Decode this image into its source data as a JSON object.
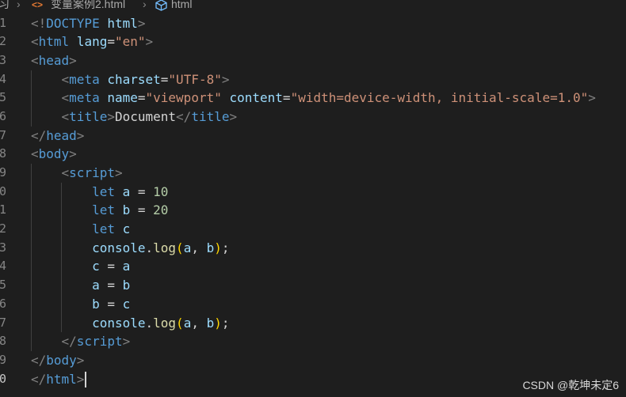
{
  "breadcrumb": {
    "folder": "习",
    "file": "变量案例2.html",
    "symbol": "html",
    "icons": {
      "separator": "chevron-right-icon",
      "file": "html-file-icon",
      "symbol": "symbol-box-icon"
    }
  },
  "editor": {
    "line_numbers": [
      "1",
      "2",
      "3",
      "4",
      "5",
      "6",
      "7",
      "8",
      "9",
      "0",
      "1",
      "2",
      "3",
      "4",
      "5",
      "6",
      "7",
      "8",
      "9",
      "0"
    ],
    "lines": [
      [
        [
          "tag-b",
          "<!"
        ],
        [
          "tag",
          "DOCTYPE"
        ],
        [
          "txt",
          " "
        ],
        [
          "attr",
          "html"
        ],
        [
          "tag-b",
          ">"
        ]
      ],
      [
        [
          "tag-b",
          "<"
        ],
        [
          "tag",
          "html"
        ],
        [
          "txt",
          " "
        ],
        [
          "attr",
          "lang"
        ],
        [
          "txt",
          "="
        ],
        [
          "str",
          "\"en\""
        ],
        [
          "tag-b",
          ">"
        ]
      ],
      [
        [
          "tag-b",
          "<"
        ],
        [
          "tag",
          "head"
        ],
        [
          "tag-b",
          ">"
        ]
      ],
      [
        [
          "txt",
          "    "
        ],
        [
          "tag-b",
          "<"
        ],
        [
          "tag",
          "meta"
        ],
        [
          "txt",
          " "
        ],
        [
          "attr",
          "charset"
        ],
        [
          "txt",
          "="
        ],
        [
          "str",
          "\"UTF-8\""
        ],
        [
          "tag-b",
          ">"
        ]
      ],
      [
        [
          "txt",
          "    "
        ],
        [
          "tag-b",
          "<"
        ],
        [
          "tag",
          "meta"
        ],
        [
          "txt",
          " "
        ],
        [
          "attr",
          "name"
        ],
        [
          "txt",
          "="
        ],
        [
          "str",
          "\"viewport\""
        ],
        [
          "txt",
          " "
        ],
        [
          "attr",
          "content"
        ],
        [
          "txt",
          "="
        ],
        [
          "str",
          "\"width=device-width, initial-scale=1.0\""
        ],
        [
          "tag-b",
          ">"
        ]
      ],
      [
        [
          "txt",
          "    "
        ],
        [
          "tag-b",
          "<"
        ],
        [
          "tag",
          "title"
        ],
        [
          "tag-b",
          ">"
        ],
        [
          "txt",
          "Document"
        ],
        [
          "tag-b",
          "</"
        ],
        [
          "tag",
          "title"
        ],
        [
          "tag-b",
          ">"
        ]
      ],
      [
        [
          "tag-b",
          "</"
        ],
        [
          "tag",
          "head"
        ],
        [
          "tag-b",
          ">"
        ]
      ],
      [
        [
          "tag-b",
          "<"
        ],
        [
          "tag",
          "body"
        ],
        [
          "tag-b",
          ">"
        ]
      ],
      [
        [
          "txt",
          "    "
        ],
        [
          "tag-b",
          "<"
        ],
        [
          "tag",
          "script"
        ],
        [
          "tag-b",
          ">"
        ]
      ],
      [
        [
          "txt",
          "        "
        ],
        [
          "kw",
          "let"
        ],
        [
          "txt",
          " "
        ],
        [
          "var",
          "a"
        ],
        [
          "txt",
          " = "
        ],
        [
          "num",
          "10"
        ]
      ],
      [
        [
          "txt",
          "        "
        ],
        [
          "kw",
          "let"
        ],
        [
          "txt",
          " "
        ],
        [
          "var",
          "b"
        ],
        [
          "txt",
          " = "
        ],
        [
          "num",
          "20"
        ]
      ],
      [
        [
          "txt",
          "        "
        ],
        [
          "kw",
          "let"
        ],
        [
          "txt",
          " "
        ],
        [
          "var",
          "c"
        ]
      ],
      [
        [
          "txt",
          "        "
        ],
        [
          "var",
          "console"
        ],
        [
          "txt",
          "."
        ],
        [
          "fn",
          "log"
        ],
        [
          "br",
          "("
        ],
        [
          "var",
          "a"
        ],
        [
          "txt",
          ", "
        ],
        [
          "var",
          "b"
        ],
        [
          "br",
          ")"
        ],
        [
          "txt",
          ";"
        ]
      ],
      [
        [
          "txt",
          "        "
        ],
        [
          "var",
          "c"
        ],
        [
          "txt",
          " = "
        ],
        [
          "var",
          "a"
        ]
      ],
      [
        [
          "txt",
          "        "
        ],
        [
          "var",
          "a"
        ],
        [
          "txt",
          " = "
        ],
        [
          "var",
          "b"
        ]
      ],
      [
        [
          "txt",
          "        "
        ],
        [
          "var",
          "b"
        ],
        [
          "txt",
          " = "
        ],
        [
          "var",
          "c"
        ]
      ],
      [
        [
          "txt",
          "        "
        ],
        [
          "var",
          "console"
        ],
        [
          "txt",
          "."
        ],
        [
          "fn",
          "log"
        ],
        [
          "br",
          "("
        ],
        [
          "var",
          "a"
        ],
        [
          "txt",
          ", "
        ],
        [
          "var",
          "b"
        ],
        [
          "br",
          ")"
        ],
        [
          "txt",
          ";"
        ]
      ],
      [
        [
          "txt",
          "    "
        ],
        [
          "tag-b",
          "</"
        ],
        [
          "tag",
          "script"
        ],
        [
          "tag-b",
          ">"
        ]
      ],
      [
        [
          "tag-b",
          "</"
        ],
        [
          "tag",
          "body"
        ],
        [
          "tag-b",
          ">"
        ]
      ],
      [
        [
          "tag-b",
          "</"
        ],
        [
          "tag",
          "html"
        ],
        [
          "tag-b",
          ">"
        ]
      ]
    ],
    "guides": [
      0,
      0,
      0,
      1,
      1,
      1,
      0,
      0,
      1,
      2,
      2,
      2,
      2,
      2,
      2,
      2,
      2,
      1,
      0,
      0
    ],
    "cursor_line": 19,
    "active_line": 19
  },
  "watermark": "CSDN @乾坤未定6"
}
